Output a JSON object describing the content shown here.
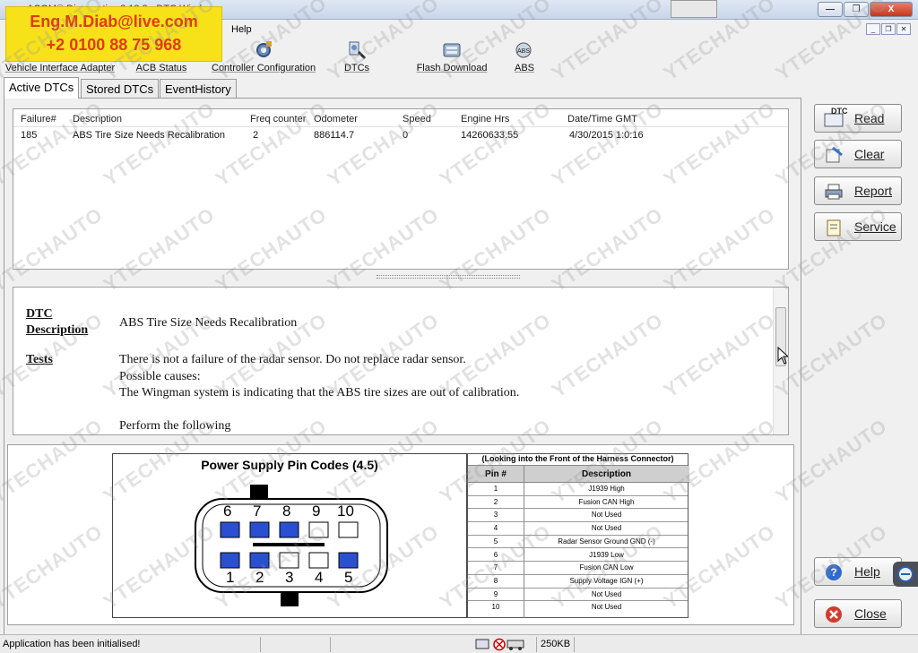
{
  "window": {
    "title": "ACOM® Diagnostics 2.13.2 - DTC Window",
    "close_label": "X",
    "min_label": "—",
    "max_label": "❐"
  },
  "banner": {
    "email": "Eng.M.Diab@live.com",
    "phone": "+2 0100 88 75 968"
  },
  "menu": {
    "help": "Help"
  },
  "toolbar": [
    {
      "label": "Vehicle Interface Adapter",
      "icon": "adapter-icon"
    },
    {
      "label": "ACB Status",
      "icon": "status-icon"
    },
    {
      "label": "Controller Configuration",
      "icon": "config-gear-icon"
    },
    {
      "label": "DTCs",
      "icon": "dtc-icon"
    },
    {
      "label": "Flash Download",
      "icon": "flash-icon"
    },
    {
      "label": "ABS",
      "icon": "abs-icon"
    }
  ],
  "tabs": [
    {
      "label": "Active DTCs",
      "active": true
    },
    {
      "label": "Stored DTCs",
      "active": false
    },
    {
      "label": "EventHistory",
      "active": false
    }
  ],
  "dtc_table": {
    "columns": [
      "Failure#",
      "Description",
      "Freq counter",
      "Odometer",
      "Speed",
      "Engine Hrs",
      "Date/Time GMT"
    ],
    "rows": [
      [
        "185",
        "ABS Tire Size Needs Recalibration",
        "2",
        "886114.7",
        "0",
        "14260633.55",
        "4/30/2015  1:0:16"
      ]
    ]
  },
  "description": {
    "dtc_heading_1": "DTC",
    "dtc_heading_2": "Description",
    "dtc_text": "ABS Tire Size Needs Recalibration",
    "tests_heading": "Tests",
    "line1": "There is not a failure of the radar sensor. Do not replace radar sensor.",
    "line2": "Possible causes:",
    "line3": "The Wingman system is indicating that the ABS tire sizes are out of calibration.",
    "line4": "Perform the following"
  },
  "pin_diagram": {
    "title": "Power Supply Pin Codes (4.5)",
    "top_pins": [
      "6",
      "7",
      "8",
      "9",
      "10"
    ],
    "bottom_pins": [
      "1",
      "2",
      "3",
      "4",
      "5"
    ]
  },
  "pin_table": {
    "caption": "(Looking into the Front of the Harness Connector)",
    "col_pin": "Pin #",
    "col_desc": "Description",
    "rows": [
      [
        "1",
        "J1939 High"
      ],
      [
        "2",
        "Fusion CAN High"
      ],
      [
        "3",
        "Not Used"
      ],
      [
        "4",
        "Not Used"
      ],
      [
        "5",
        "Radar Sensor Ground GND (-)"
      ],
      [
        "6",
        "J1939 Low"
      ],
      [
        "7",
        "Fusion CAN Low"
      ],
      [
        "8",
        "Supply Voltage IGN (+)"
      ],
      [
        "9",
        "Not Used"
      ],
      [
        "10",
        "Not Used"
      ]
    ]
  },
  "buttons": {
    "read": "Read",
    "read_badge": "DTC",
    "clear": "Clear",
    "report": "Report",
    "service": "Service",
    "help": "Help",
    "close": "Close"
  },
  "status": {
    "message": "Application has been initialised!",
    "size": "250KB"
  },
  "watermark": "YTECHAUTO",
  "colors": {
    "pin_blue": "#2a4fd0",
    "banner_yellow": "#f7e21a",
    "banner_text": "#e23a0c"
  }
}
